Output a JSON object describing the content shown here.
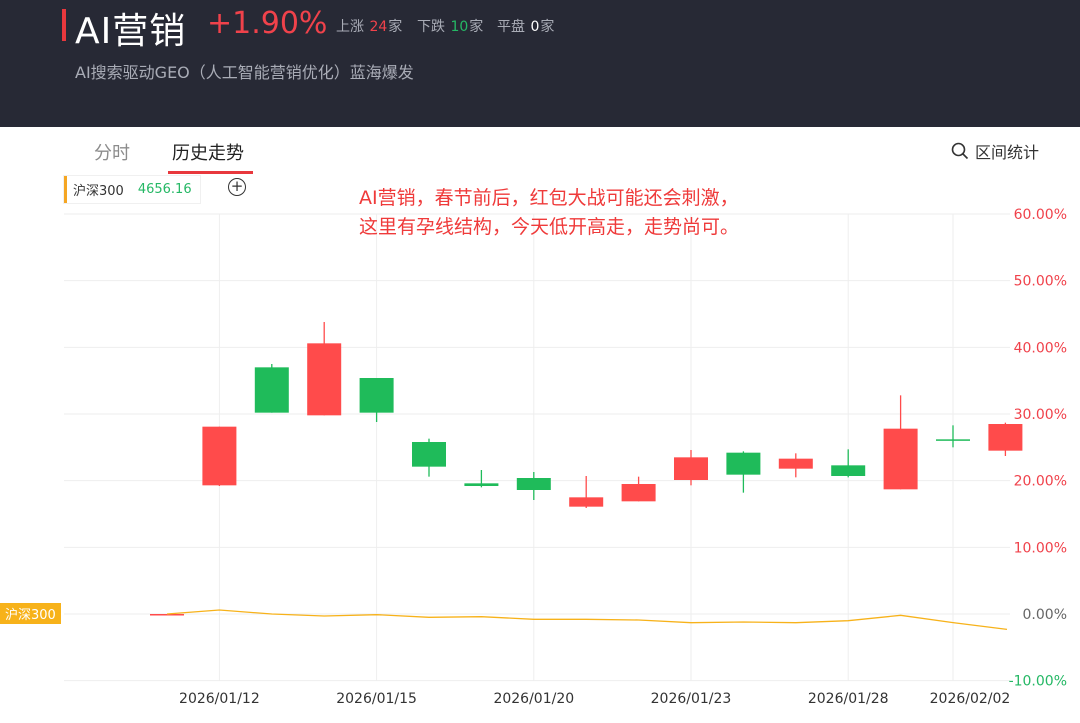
{
  "header": {
    "title": "AI营销",
    "change_pct": "+1.90%",
    "up_label": "上涨",
    "up_count": "24",
    "down_label": "下跌",
    "down_count": "10",
    "flat_label": "平盘",
    "flat_count": "0",
    "unit": "家",
    "subtitle": "AI搜索驱动GEO（人工智能营销优化）蓝海爆发"
  },
  "tabs": [
    {
      "label": "分时",
      "active": false
    },
    {
      "label": "历史走势",
      "active": true
    }
  ],
  "range_stats_label": "区间统计",
  "legend": {
    "name": "沪深300",
    "value": "4656.16",
    "add_symbol": "+"
  },
  "annotation": "AI营销，春节前后，红包大战可能还会刺激，\n这里有孕线结构，今天低开高走，走势尚可。",
  "colors": {
    "up": "#ff4b4b",
    "down": "#1fbb5a",
    "index_line": "#f7b21a",
    "header_bg": "#272935"
  },
  "chart_data": {
    "type": "candlestick",
    "y_unit": "%",
    "ylim": [
      -10,
      60
    ],
    "y_ticks": [
      "60.00%",
      "50.00%",
      "40.00%",
      "30.00%",
      "20.00%",
      "10.00%",
      "0.00%",
      "-10.00%"
    ],
    "x_ticks": [
      "2026/01/12",
      "2026/01/15",
      "2026/01/20",
      "2026/01/23",
      "2026/01/28",
      "2026/02/02"
    ],
    "candles": [
      {
        "o": 0.0,
        "h": 0.0,
        "l": 0.0,
        "c": 0.0
      },
      {
        "o": 19.3,
        "h": 28.1,
        "l": 19.2,
        "c": 28.1
      },
      {
        "o": 37.0,
        "h": 37.5,
        "l": 30.2,
        "c": 30.2
      },
      {
        "o": 29.8,
        "h": 43.8,
        "l": 29.8,
        "c": 40.6
      },
      {
        "o": 35.4,
        "h": 35.4,
        "l": 28.8,
        "c": 30.2
      },
      {
        "o": 25.8,
        "h": 26.3,
        "l": 20.6,
        "c": 22.1
      },
      {
        "o": 19.6,
        "h": 21.6,
        "l": 19.0,
        "c": 19.2
      },
      {
        "o": 20.4,
        "h": 21.3,
        "l": 17.1,
        "c": 18.6
      },
      {
        "o": 16.1,
        "h": 20.7,
        "l": 15.9,
        "c": 17.5
      },
      {
        "o": 16.9,
        "h": 20.6,
        "l": 16.9,
        "c": 19.5
      },
      {
        "o": 20.1,
        "h": 24.6,
        "l": 19.3,
        "c": 23.5
      },
      {
        "o": 24.2,
        "h": 24.4,
        "l": 18.2,
        "c": 20.9
      },
      {
        "o": 21.8,
        "h": 24.1,
        "l": 20.5,
        "c": 23.3
      },
      {
        "o": 22.3,
        "h": 24.7,
        "l": 20.5,
        "c": 20.7
      },
      {
        "o": 18.7,
        "h": 32.8,
        "l": 18.7,
        "c": 27.8
      },
      {
        "o": 26.2,
        "h": 28.3,
        "l": 25.0,
        "c": 26.1
      },
      {
        "o": 24.5,
        "h": 28.7,
        "l": 23.7,
        "c": 28.5
      }
    ],
    "index_series": {
      "name": "沪深300",
      "values": [
        0.0,
        0.6,
        0.0,
        -0.3,
        -0.1,
        -0.5,
        -0.4,
        -0.8,
        -0.8,
        -0.9,
        -1.3,
        -1.2,
        -1.3,
        -1.0,
        -0.2,
        -1.3,
        -2.3
      ]
    }
  }
}
